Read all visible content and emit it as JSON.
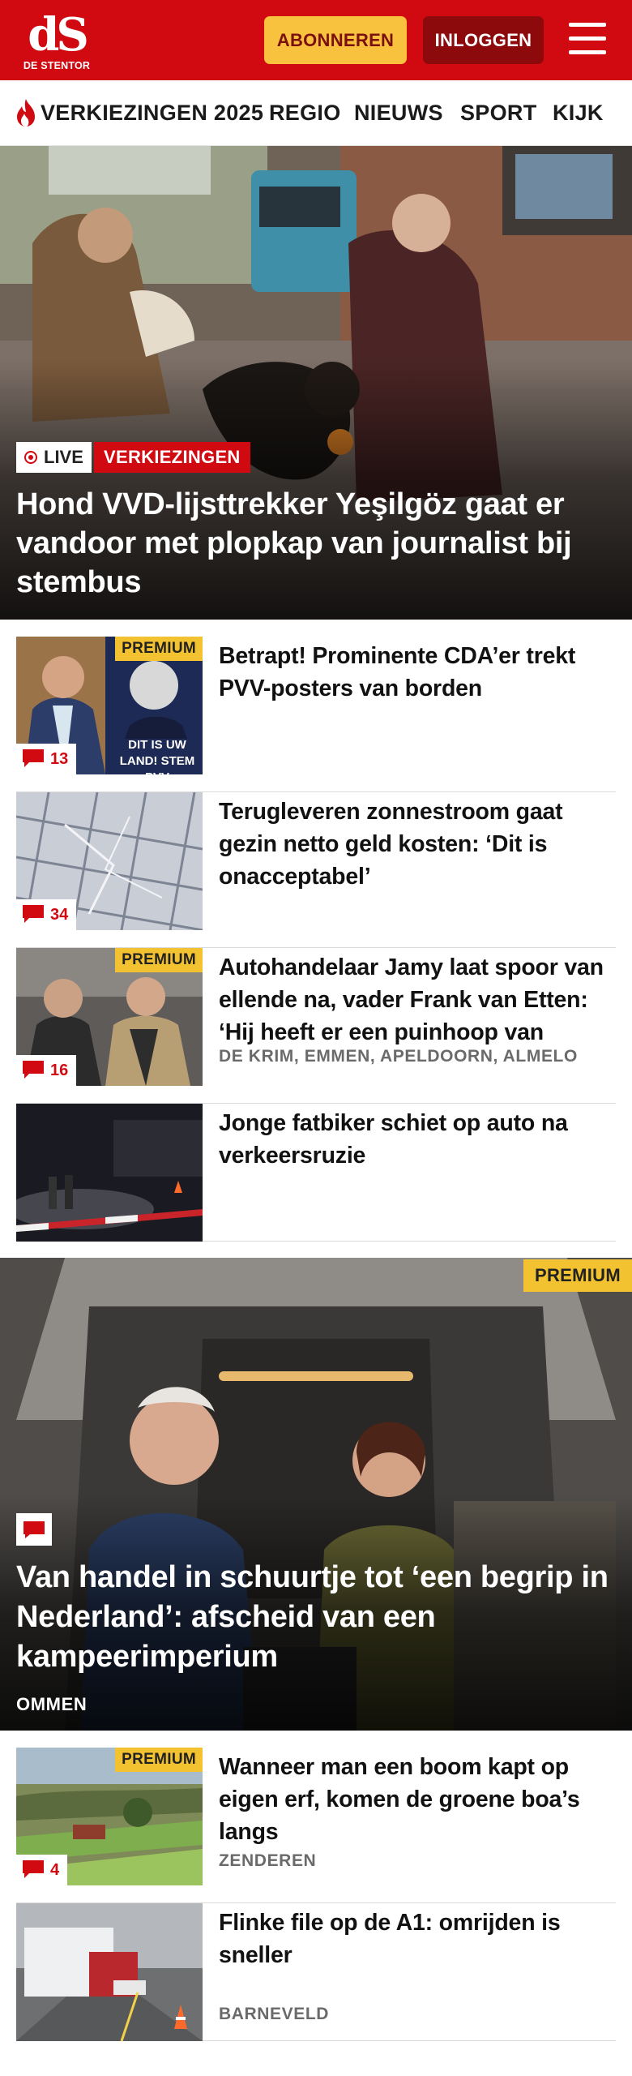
{
  "header": {
    "logo_mark": "dS",
    "logo_text": "DE STENTOR",
    "subscribe_label": "ABONNEREN",
    "login_label": "INLOGGEN",
    "menu_icon": "hamburger-menu-icon",
    "brand_color": "#d10a11"
  },
  "nav": {
    "items": [
      {
        "label": "VERKIEZINGEN 2025",
        "icon": "flame-icon"
      },
      {
        "label": "REGIO"
      },
      {
        "label": "NIEUWS"
      },
      {
        "label": "SPORT"
      },
      {
        "label": "KIJK"
      }
    ]
  },
  "hero": {
    "live_label": "LIVE",
    "category_label": "VERKIEZINGEN",
    "title": "Hond VVD-lijsttrekker Yeşilgöz gaat er vandoor met plopkap van journalist bij stembus"
  },
  "articles": [
    {
      "title": "Betrapt! Prominente CDA’er trekt PVV-posters van borden",
      "premium": "PREMIUM",
      "comments": "13",
      "location": "",
      "thumb_caption": "DIT IS UW LAND! STEM PVV"
    },
    {
      "title": "Terugleveren zonnestroom gaat gezin netto geld kosten: ‘Dit is onacceptabel’",
      "premium": "",
      "comments": "34",
      "location": ""
    },
    {
      "title": "Autohandelaar Jamy laat spoor van ellende na, vader Frank van Etten: ‘Hij heeft er een puinhoop van gemaakt’",
      "premium": "PREMIUM",
      "comments": "16",
      "location": "DE KRIM, EMMEN, APELDOORN, ALMELO"
    },
    {
      "title": "Jonge fatbiker schiet op auto na verkeersruzie",
      "premium": "",
      "comments": "",
      "location": ""
    }
  ],
  "feature": {
    "premium": "PREMIUM",
    "title": "Van handel in schuurtje tot ‘een begrip in Nederland’: afscheid van een kampeerimperium",
    "location": "OMMEN"
  },
  "articles_bottom": [
    {
      "title": "Wanneer man een boom kapt op eigen erf, komen de groene boa’s langs",
      "premium": "PREMIUM",
      "comments": "4",
      "location": "ZENDEREN"
    },
    {
      "title": "Flinke file op de A1: omrijden is sneller",
      "premium": "",
      "comments": "",
      "location": "BARNEVELD"
    }
  ],
  "colors": {
    "premium_badge": "#f2c230",
    "live_badge_red": "#d10a11",
    "subscribe_yellow": "#f8c23f",
    "login_dark_red": "#8d0a0c"
  }
}
